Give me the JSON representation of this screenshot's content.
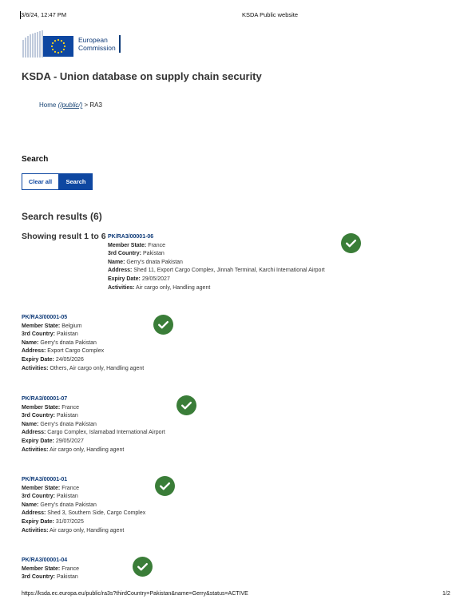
{
  "print_header": {
    "datetime": "3/6/24, 12:47 PM",
    "site_title": "KSDA Public website"
  },
  "logo": {
    "line1": "European",
    "line2": "Commission"
  },
  "page_title": "KSDA - Union database on supply chain security",
  "breadcrumb": {
    "home": "Home",
    "home_href": "(/public/)",
    "separator": " > ",
    "current": "RA3"
  },
  "search": {
    "heading": "Search",
    "clear_label": "Clear all",
    "search_label": "Search"
  },
  "results": {
    "heading": "Search results (6)",
    "showing": "Showing result 1 to 6",
    "labels": {
      "member_state": "Member State:",
      "third_country": "3rd Country:",
      "name": "Name:",
      "address": "Address:",
      "expiry": "Expiry Date:",
      "activities": "Activities:"
    },
    "items": [
      {
        "id": "PK/RA3/00001-06",
        "member_state": "France",
        "third_country": "Pakistan",
        "name": "Gerry's dnata Pakistan",
        "address": "Shed 11, Export Cargo Complex, Jinnah Terminal, Karchi International Airport",
        "expiry": "29/05/2027",
        "activities": "Air cargo only, Handling agent",
        "status_icon": "check-circle-icon"
      },
      {
        "id": "PK/RA3/00001-05",
        "member_state": "Belgium",
        "third_country": "Pakistan",
        "name": "Gerry's dnata Pakistan",
        "address": "Export Cargo Complex",
        "expiry": "24/05/2026",
        "activities": "Others, Air cargo only, Handling agent",
        "status_icon": "check-circle-icon"
      },
      {
        "id": "PK/RA3/00001-07",
        "member_state": "France",
        "third_country": "Pakistan",
        "name": "Gerry's dnata Pakistan",
        "address": "Cargo Complex, Islamabad International Airport",
        "expiry": "29/05/2027",
        "activities": "Air cargo only, Handling agent",
        "status_icon": "check-circle-icon"
      },
      {
        "id": "PK/RA3/00001-01",
        "member_state": "France",
        "third_country": "Pakistan",
        "name": "Gerry's dnata Pakistan",
        "address": "Shed 3, Southern Side, Cargo Complex",
        "expiry": "31/07/2025",
        "activities": "Air cargo only, Handling agent",
        "status_icon": "check-circle-icon"
      },
      {
        "id": "PK/RA3/00001-04",
        "member_state": "France",
        "third_country": "Pakistan",
        "status_icon": "check-circle-icon"
      }
    ]
  },
  "print_footer": {
    "url": "https://ksda.ec.europa.eu/public/ra3s?thirdCountry=Pakistan&name=Gerry&status=ACTIVE",
    "page": "1/2"
  },
  "colors": {
    "brand_blue": "#0e47a1",
    "status_green": "#3a7d38"
  }
}
